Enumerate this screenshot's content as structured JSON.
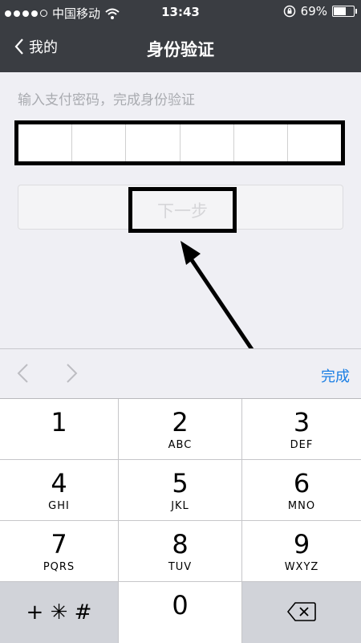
{
  "status_bar": {
    "carrier": "中国移动",
    "time": "13:43",
    "battery": "69%",
    "battery_level": 0.69
  },
  "nav": {
    "back_label": "我的",
    "title": "身份验证"
  },
  "prompt": "输入支付密码，完成身份验证",
  "next_button": {
    "label": "下一步"
  },
  "accessory": {
    "done": "完成"
  },
  "keypad": [
    {
      "num": "1",
      "letters": ""
    },
    {
      "num": "2",
      "letters": "ABC"
    },
    {
      "num": "3",
      "letters": "DEF"
    },
    {
      "num": "4",
      "letters": "GHI"
    },
    {
      "num": "5",
      "letters": "JKL"
    },
    {
      "num": "6",
      "letters": "MNO"
    },
    {
      "num": "7",
      "letters": "PQRS"
    },
    {
      "num": "8",
      "letters": "TUV"
    },
    {
      "num": "9",
      "letters": "WXYZ"
    },
    {
      "num": "+ ✳ #",
      "letters": ""
    },
    {
      "num": "0",
      "letters": ""
    }
  ],
  "colors": {
    "header_bg": "#3a3d42",
    "accent": "#1a7ee4",
    "page_bg": "#efeff4"
  }
}
